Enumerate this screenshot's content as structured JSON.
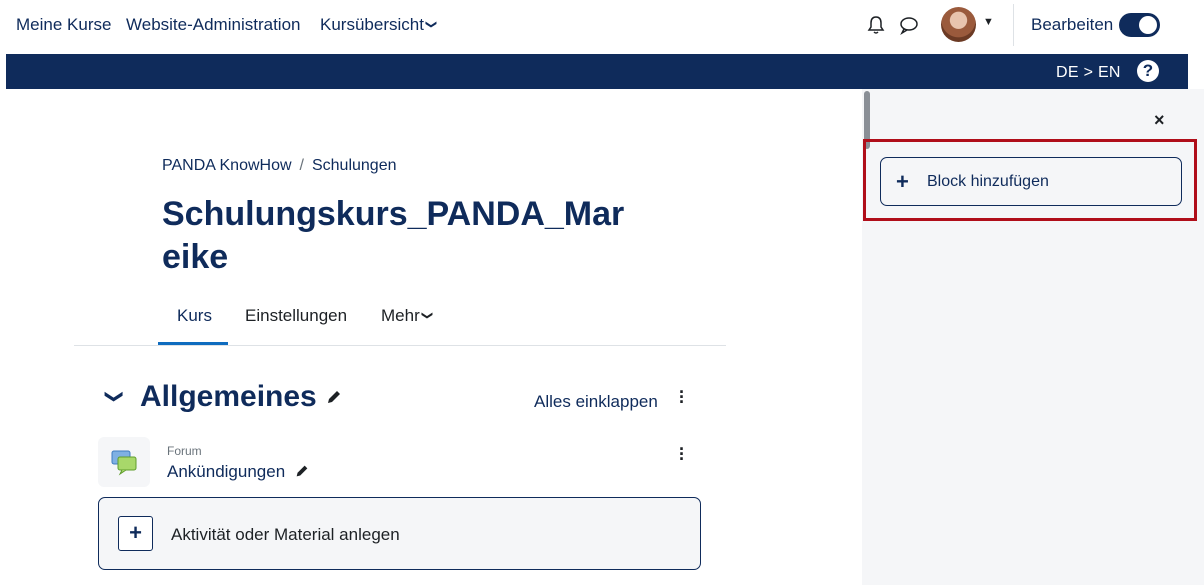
{
  "nav": {
    "my_courses": "Meine Kurse",
    "site_admin": "Website-Administration",
    "course_overview": "Kursübersicht",
    "edit_mode_label": "Bearbeiten",
    "edit_mode_on": true
  },
  "band": {
    "language": "DE > EN",
    "help": "?"
  },
  "drawer": {
    "close": "×",
    "add_block": "Block hinzufügen"
  },
  "breadcrumb": {
    "items": [
      "PANDA KnowHow",
      "Schulungen"
    ],
    "separator": "/"
  },
  "course": {
    "title": "Schulungskurs_PANDA_Mareike"
  },
  "tabs": {
    "items": [
      "Kurs",
      "Einstellungen",
      "Mehr"
    ],
    "active": "Kurs"
  },
  "section": {
    "title": "Allgemeines",
    "collapse_all": "Alles einklappen"
  },
  "activity": {
    "type": "Forum",
    "name": "Ankündigungen"
  },
  "add_activity": {
    "label": "Aktivität oder Material anlegen"
  },
  "colors": {
    "brand": "#0f2b5b",
    "accent": "#0f6cbf",
    "highlight": "#b00e1a",
    "drawer_bg": "#f5f6f8"
  }
}
